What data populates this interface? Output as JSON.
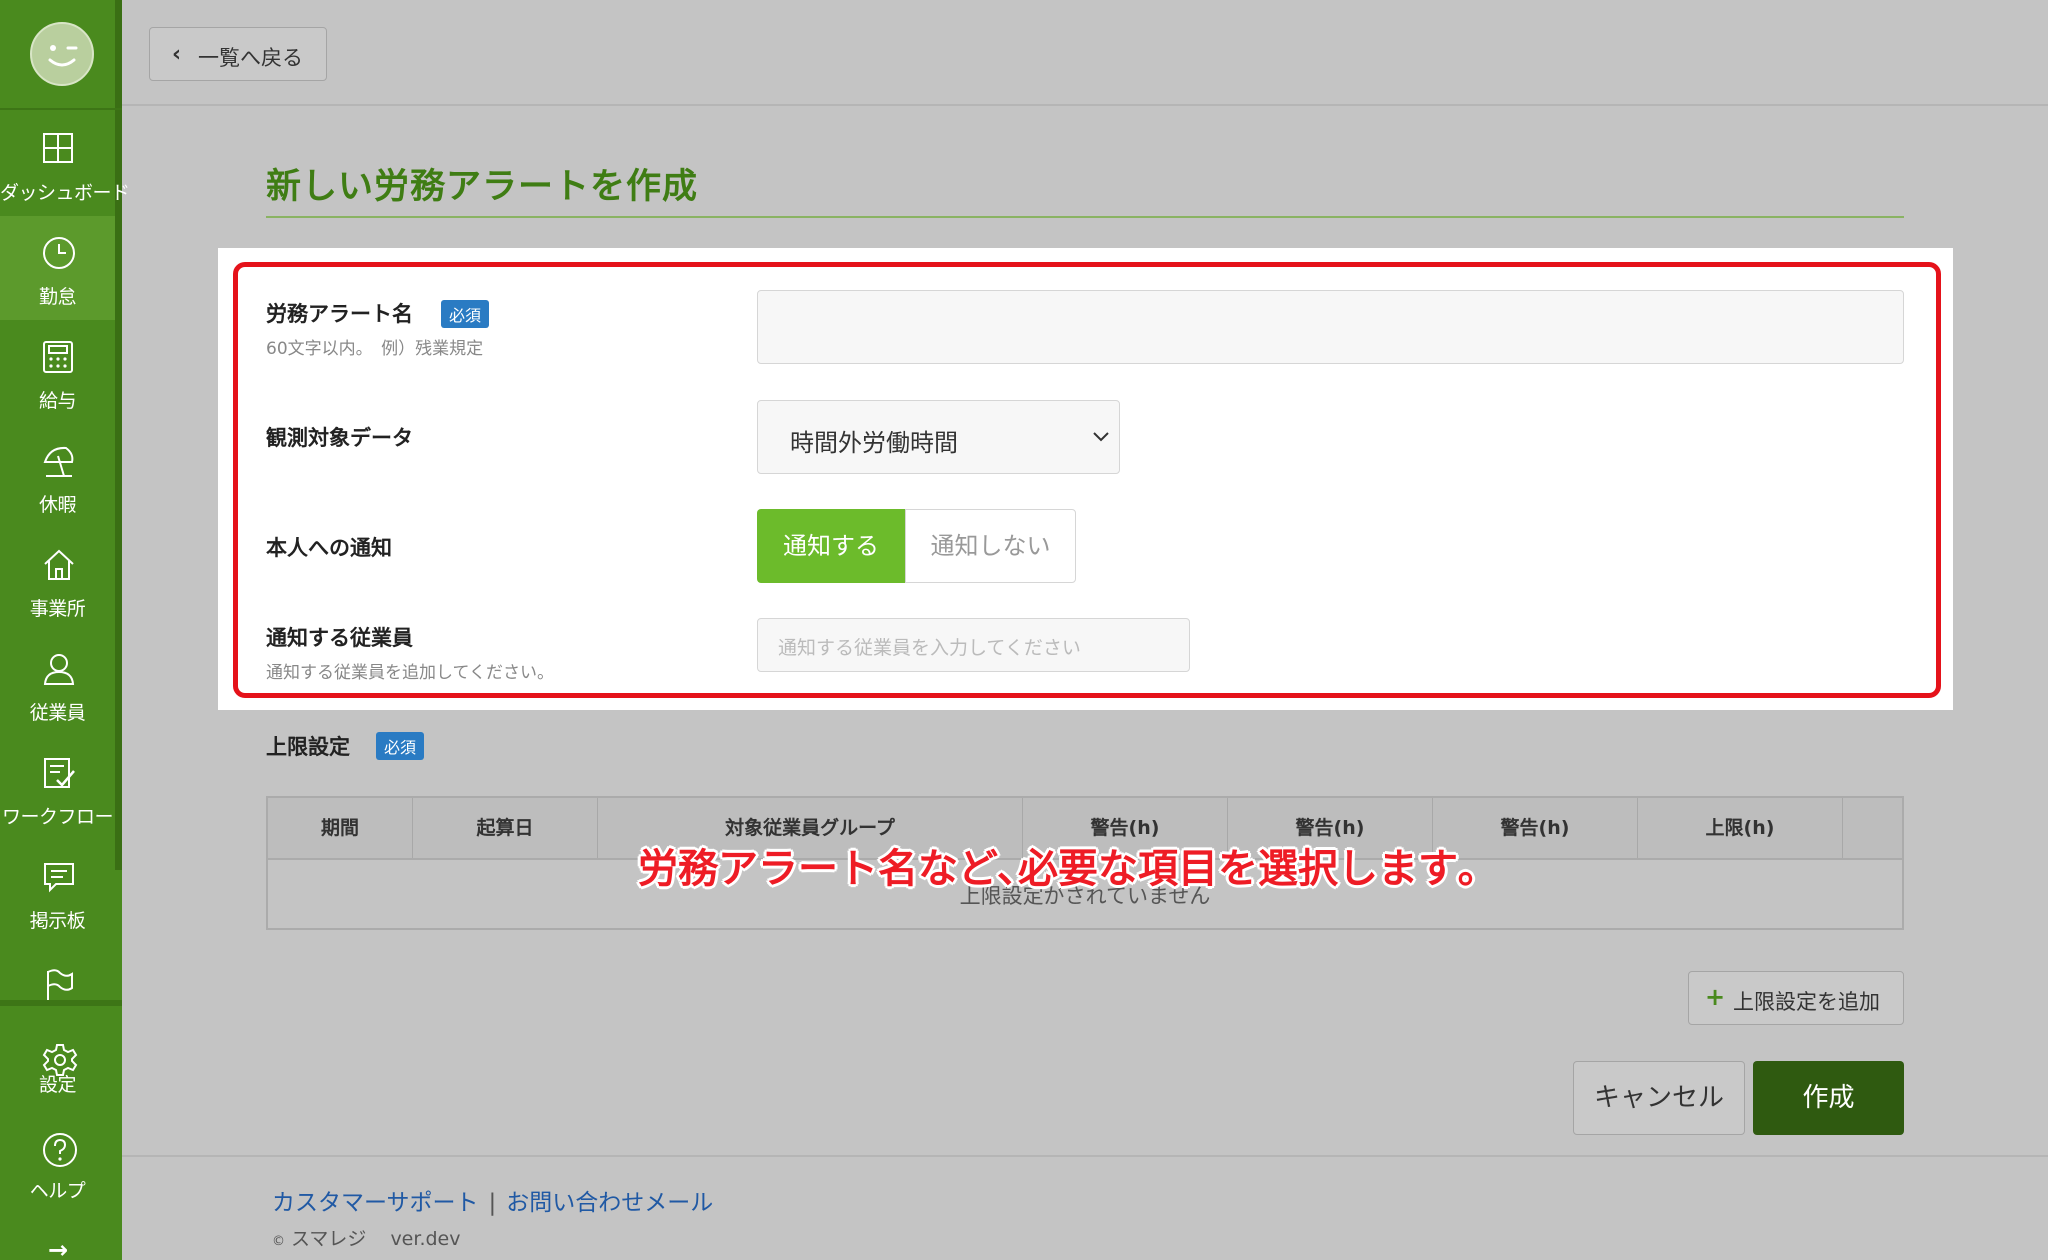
{
  "sidebar": {
    "items": [
      {
        "label": "ダッシュボード",
        "icon": "dashboard-icon"
      },
      {
        "label": "勤怠",
        "icon": "clock-icon"
      },
      {
        "label": "給与",
        "icon": "calculator-icon"
      },
      {
        "label": "休暇",
        "icon": "beach-umbrella-icon"
      },
      {
        "label": "事業所",
        "icon": "home-icon"
      },
      {
        "label": "従業員",
        "icon": "person-icon"
      },
      {
        "label": "ワークフロー",
        "icon": "checklist-icon"
      },
      {
        "label": "掲示板",
        "icon": "message-board-icon"
      },
      {
        "label": "",
        "icon": "flag-icon"
      },
      {
        "label": "設定",
        "icon": "gear-icon"
      },
      {
        "label": "ヘルプ",
        "icon": "help-icon"
      }
    ],
    "active": "勤怠"
  },
  "topbar": {
    "back_label": "一覧へ戻る"
  },
  "page": {
    "title": "新しい労務アラートを作成"
  },
  "form": {
    "alert_name": {
      "label": "労務アラート名",
      "required_badge": "必須",
      "hint": "60文字以内。　例）残業規定",
      "value": ""
    },
    "observed_data": {
      "label": "観測対象データ",
      "selected": "時間外労働時間"
    },
    "notify_self": {
      "label": "本人への通知",
      "on_label": "通知する",
      "off_label": "通知しない",
      "selected": "通知する"
    },
    "notify_employees": {
      "label": "通知する従業員",
      "hint": "通知する従業員を追加してください。",
      "placeholder": "通知する従業員を入力してください"
    }
  },
  "limits": {
    "label": "上限設定",
    "required_badge": "必須",
    "columns": [
      "期間",
      "起算日",
      "対象従業員グループ",
      "警告(h)",
      "警告(h)",
      "警告(h)",
      "上限(h)",
      ""
    ],
    "empty_message": "上限設定がされていません",
    "add_label": "上限設定を追加"
  },
  "actions": {
    "cancel_label": "キャンセル",
    "create_label": "作成"
  },
  "footer": {
    "support_link": "カスタマーサポート",
    "separator": "|",
    "contact_link": "お問い合わせメール",
    "copyright": "©",
    "brand": "スマレジ",
    "version": "ver.dev"
  },
  "annotation": {
    "text": "労務アラート名など､必要な項目を選択します｡"
  },
  "colors": {
    "sidebar": "#4a8a1e",
    "accent_green": "#6cbb2b",
    "create_button": "#2f5a10",
    "badge_blue": "#2a7bc3",
    "annotation_red": "#ee1c25"
  }
}
